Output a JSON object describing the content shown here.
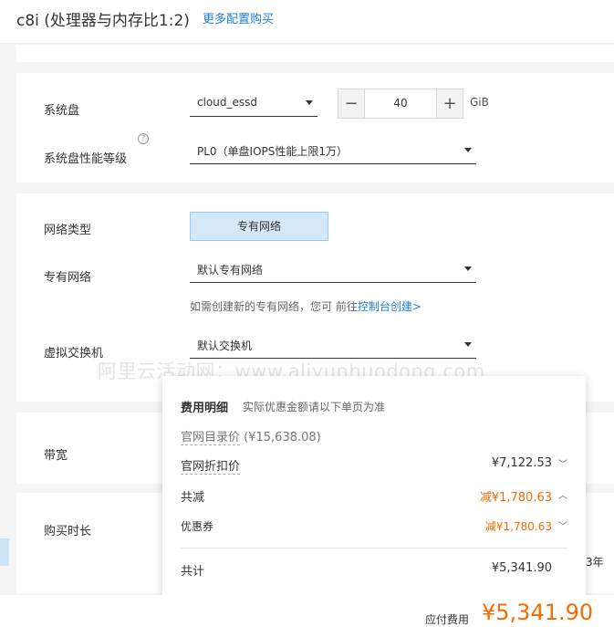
{
  "header": {
    "title": "c8i (处理器与内存比1:2)",
    "more_link": "更多配置购买"
  },
  "disk": {
    "label": "系统盘",
    "type_value": "cloud_essd",
    "size_value": "40",
    "unit": "GiB",
    "perf_label": "系统盘性能等级",
    "perf_value": "PL0（单盘IOPS性能上限1万）"
  },
  "network": {
    "type_label": "网络类型",
    "type_button": "专有网络",
    "vpc_label": "专有网络",
    "vpc_value": "默认专有网络",
    "hint_text": "如需创建新的专有网络，您可 前往",
    "hint_link": "控制台创建>",
    "vswitch_label": "虚拟交换机",
    "vswitch_value": "默认交换机"
  },
  "bandwidth": {
    "label": "带宽"
  },
  "duration": {
    "label": "购买时长",
    "year_fragment": "3年"
  },
  "watermark": "阿里云活动网：www.aliyunhuodong.com",
  "cost_popup": {
    "title": "费用明细",
    "subtitle": "实际优惠金额请以下单页为准",
    "catalog_label": "官网目录价",
    "catalog_value": "(¥15,638.08)",
    "rows": [
      {
        "label": "官网折扣价",
        "value": "¥7,122.53"
      },
      {
        "label": "共减",
        "value": "减¥1,780.63"
      },
      {
        "label": "优惠券",
        "value": "减¥1,780.63"
      },
      {
        "label": "共计",
        "value": "¥5,341.90"
      }
    ]
  },
  "footer": {
    "payable_label": "应付费用",
    "payable_value": "¥5,341.90"
  },
  "colors": {
    "accent": "#1e80d2",
    "price": "#f56b00"
  }
}
